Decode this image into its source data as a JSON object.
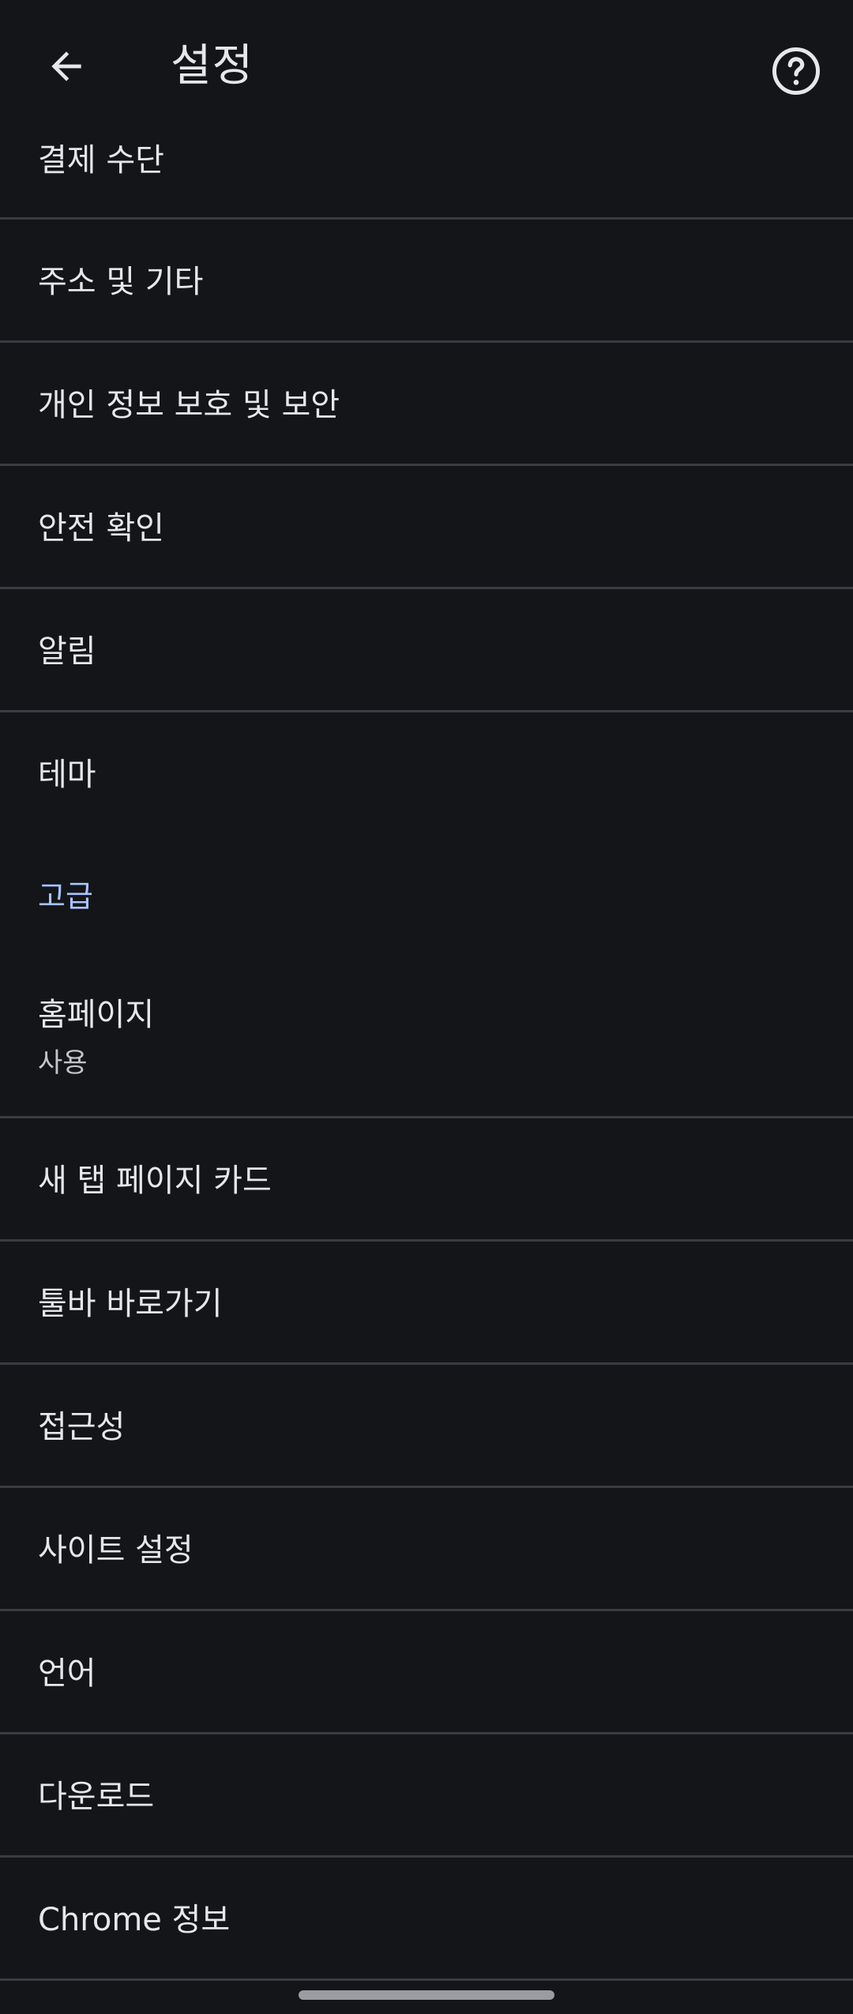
{
  "header": {
    "title": "설정",
    "back_icon": "arrow-left-icon",
    "help_icon": "help-circle-icon"
  },
  "items": [
    {
      "label": "결제 수단"
    },
    {
      "label": "주소 및 기타"
    },
    {
      "label": "개인 정보 보호 및 보안"
    },
    {
      "label": "안전 확인"
    },
    {
      "label": "알림"
    },
    {
      "label": "테마"
    }
  ],
  "advanced_section": {
    "title": "고급",
    "items": [
      {
        "label": "홈페이지",
        "sublabel": "사용"
      },
      {
        "label": "새 탭 페이지 카드"
      },
      {
        "label": "툴바 바로가기"
      },
      {
        "label": "접근성"
      },
      {
        "label": "사이트 설정"
      },
      {
        "label": "언어"
      },
      {
        "label": "다운로드"
      },
      {
        "label": "Chrome 정보"
      }
    ]
  },
  "colors": {
    "background": "#141519",
    "text": "#e6e7ea",
    "section_accent": "#a8c4ff",
    "divider": "#3a3c41"
  }
}
